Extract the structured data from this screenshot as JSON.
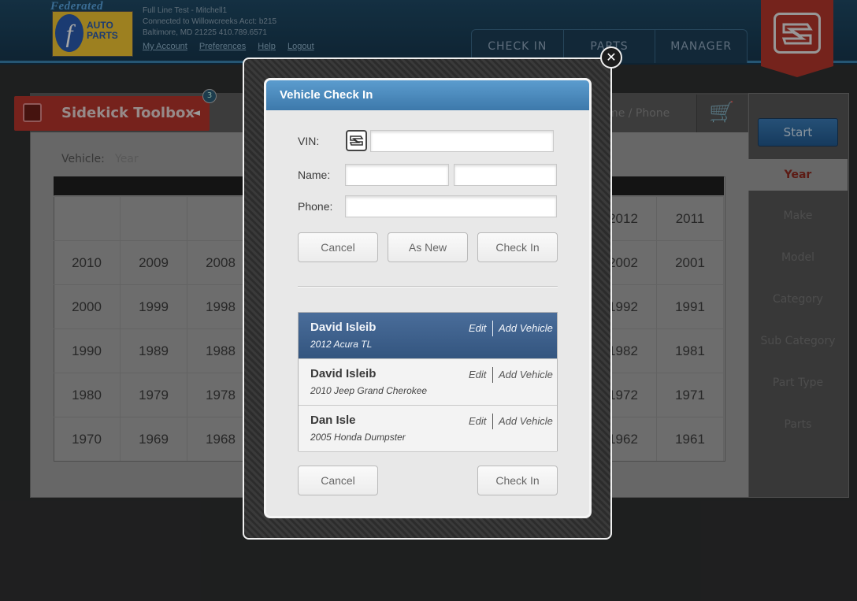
{
  "header": {
    "logo_top": "Federated",
    "logo_emblem": "f",
    "logo_words": "AUTO PARTS",
    "account_lines": [
      "Full Line Test - Mitchell1",
      "Connected to Willowcreeks Acct: b215",
      "Baltimore, MD 21225 410.789.6571"
    ],
    "account_links": [
      "My Account",
      "Preferences",
      "Help",
      "Logout"
    ],
    "nav_tabs": [
      "CHECK IN",
      "PARTS",
      "MANAGER"
    ]
  },
  "toolbox": {
    "label": "Sidekick Toolbox",
    "badge": "3",
    "collapse_arrow": "◄"
  },
  "search_hint": "Name / Phone",
  "vehicle": {
    "label": "Vehicle:",
    "value": "Year"
  },
  "years": [
    [
      "",
      "",
      "",
      "",
      "",
      "",
      "",
      "",
      "2012",
      "2011"
    ],
    [
      "2010",
      "2009",
      "2008",
      "",
      "",
      "",
      "",
      "",
      "2002",
      "2001"
    ],
    [
      "2000",
      "1999",
      "1998",
      "",
      "",
      "",
      "",
      "",
      "1992",
      "1991"
    ],
    [
      "1990",
      "1989",
      "1988",
      "",
      "",
      "",
      "",
      "",
      "1982",
      "1981"
    ],
    [
      "1980",
      "1979",
      "1978",
      "",
      "",
      "",
      "",
      "",
      "1972",
      "1971"
    ],
    [
      "1970",
      "1969",
      "1968",
      "",
      "",
      "",
      "",
      "",
      "1962",
      "1961"
    ]
  ],
  "sidebar": {
    "start": "Start",
    "items": [
      "Year",
      "Make",
      "Model",
      "Category",
      "Sub Category",
      "Part Type",
      "Parts"
    ],
    "active": "Year"
  },
  "dialog": {
    "title": "Vehicle Check In",
    "vin_label": "VIN:",
    "name_label": "Name:",
    "phone_label": "Phone:",
    "vin_value": "",
    "first_name_value": "",
    "last_name_value": "",
    "phone_value": "",
    "buttons_top": {
      "cancel": "Cancel",
      "as_new": "As New",
      "check_in": "Check In"
    },
    "results": [
      {
        "name": "David Isleib",
        "vehicle": "2012 Acura TL",
        "edit": "Edit",
        "add": "Add Vehicle",
        "selected": true
      },
      {
        "name": "David Isleib",
        "vehicle": "2010 Jeep Grand Cherokee",
        "edit": "Edit",
        "add": "Add Vehicle",
        "selected": false
      },
      {
        "name": "Dan Isle",
        "vehicle": "2005 Honda Dumpster",
        "edit": "Edit",
        "add": "Add Vehicle",
        "selected": false
      }
    ],
    "buttons_bottom": {
      "cancel": "Cancel",
      "check_in": "Check In"
    },
    "close_glyph": "✕"
  },
  "colors": {
    "header_bg": "#1f4a66",
    "accent_blue": "#3d79ab",
    "selected_row": "#3a5d88",
    "toolbox_red": "#b5352b",
    "active_sidebar_text": "#8e2a20"
  },
  "icons": {
    "cart": "shopping-cart-icon",
    "vin_scan": "sidekick-logo-icon",
    "close": "close-icon",
    "toolbox": "sidekick-logo-icon"
  }
}
